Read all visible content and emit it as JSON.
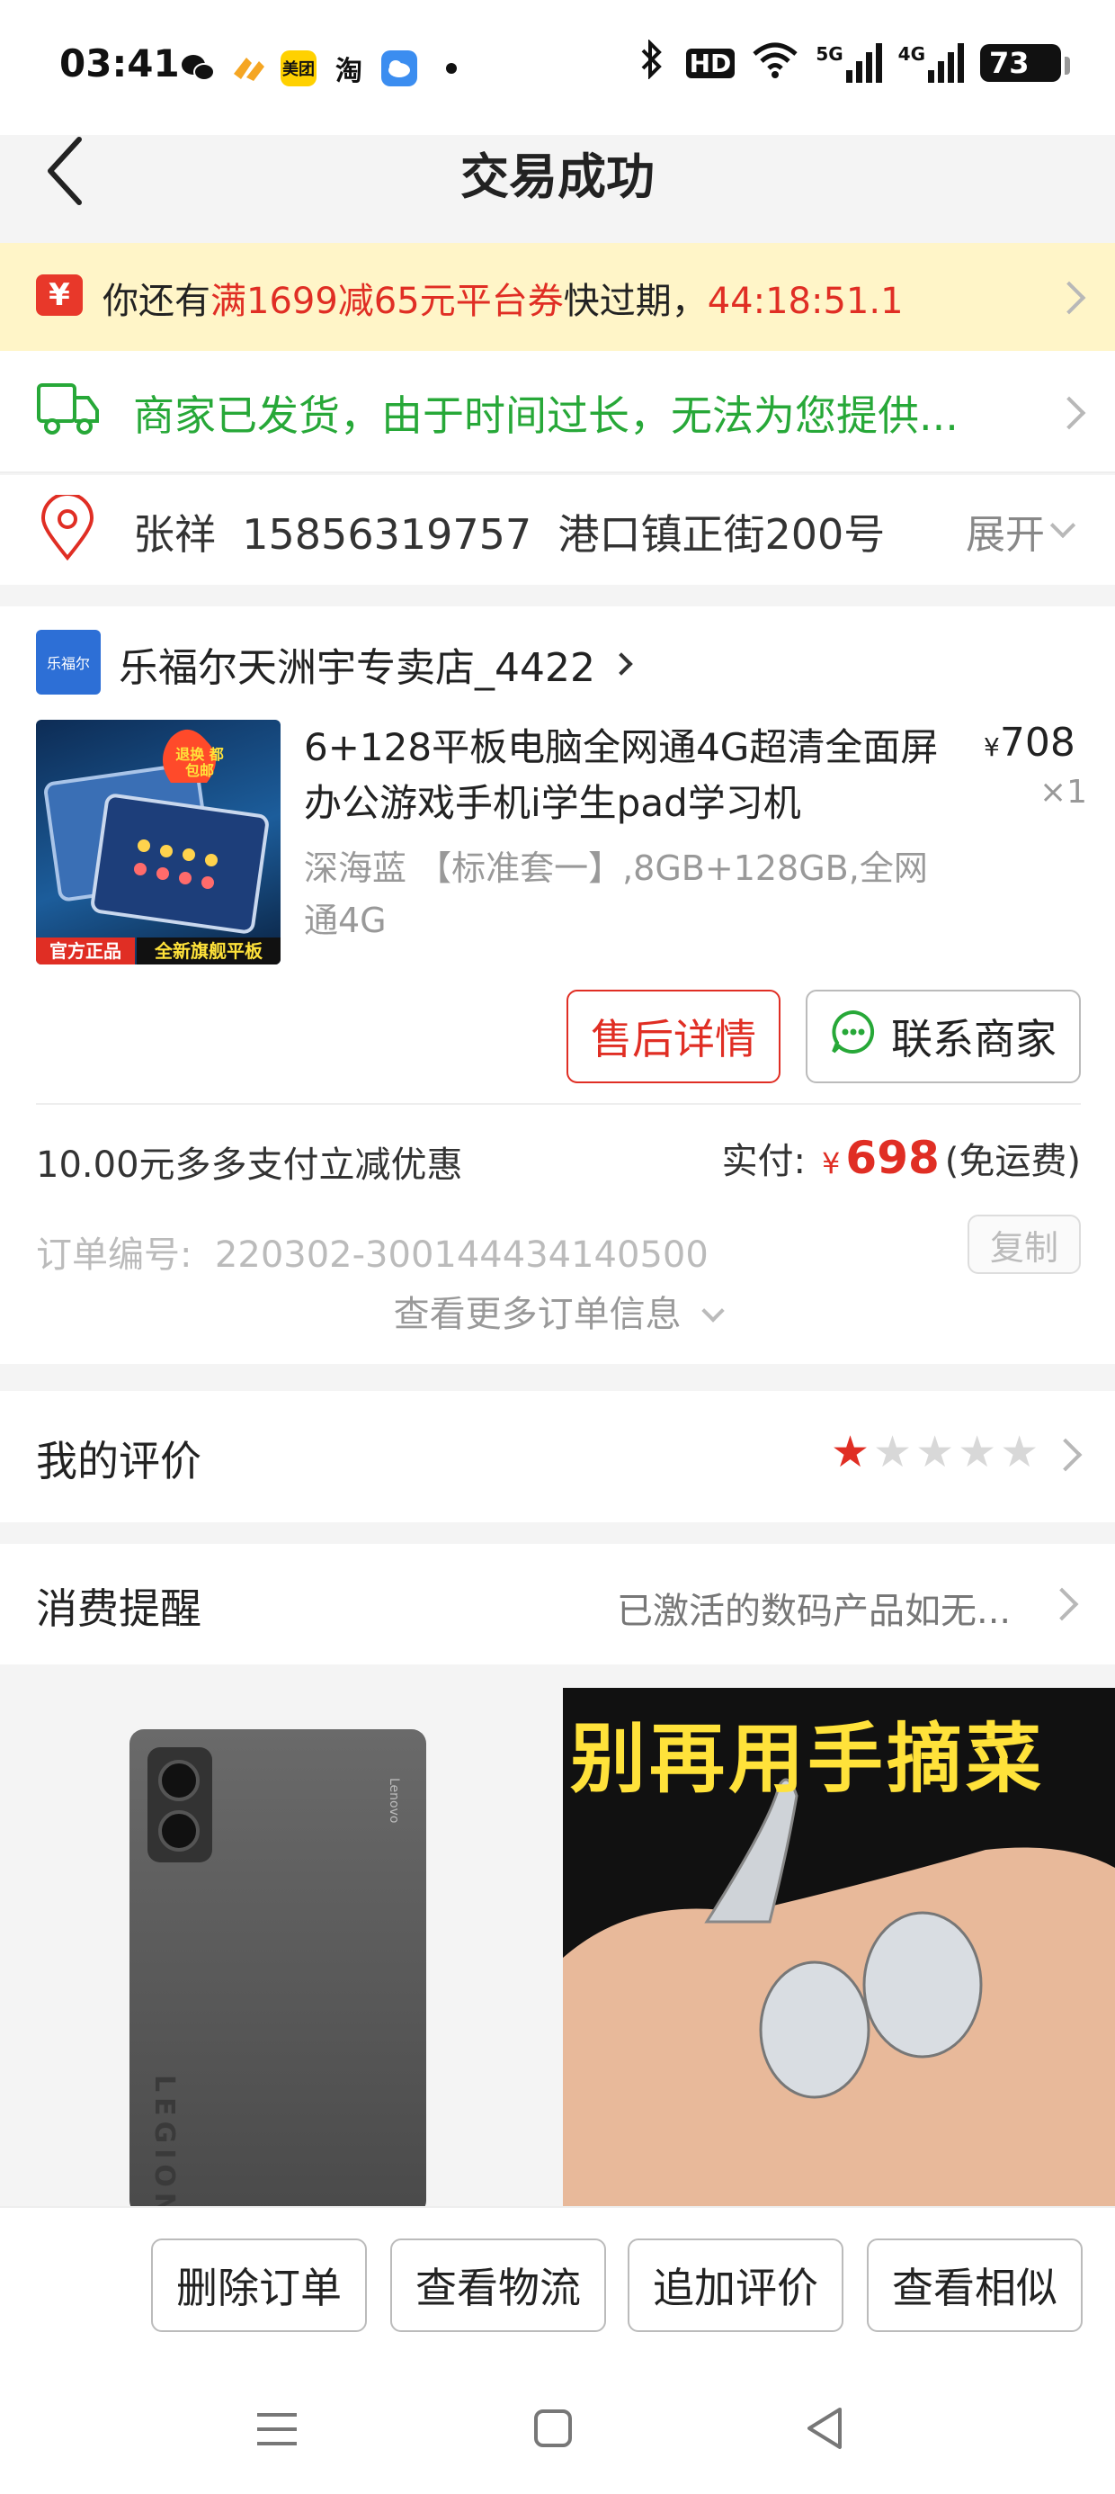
{
  "status_bar": {
    "time": "03:41",
    "apps": [
      {
        "icon": "wechat-icon",
        "color": "#111111",
        "label": ""
      },
      {
        "icon": "app-orange-icon",
        "color": "#f5a623",
        "label": ""
      },
      {
        "icon": "meituan-icon",
        "color": "#ffd100",
        "label": "美团"
      },
      {
        "icon": "taobao-icon",
        "color": "#ffffff",
        "label": "淘"
      },
      {
        "icon": "weather-icon",
        "color": "#3b8df0",
        "label": ""
      }
    ],
    "hd": "HD",
    "net_5g": "5G",
    "net_4g": "4G",
    "battery": "73"
  },
  "nav": {
    "title": "交易成功"
  },
  "coupon": {
    "icon": "¥",
    "prefix": "你还有",
    "highlight": "满1699减65元平台券",
    "middle": "快过期，",
    "countdown": "44:18:51.1"
  },
  "shipping": {
    "text": "商家已发货，由于时间过长，无法为您提供..."
  },
  "address": {
    "name": "张祥",
    "phone": "15856319757",
    "street": "港口镇正街200号",
    "expand_label": "展开"
  },
  "order": {
    "store_logo": "乐福尔",
    "store_name": "乐福尔天洲宇专卖店_4422",
    "product": {
      "badge_top": "退换 都包邮",
      "badge_left": "官方正品",
      "badge_right": "全新旗舰平板",
      "title": "6+128平板电脑全网通4G超清全面屏办公游戏手机i学生pad学习机",
      "spec": "深海蓝 【标准套一】,8GB+128GB,全网通4G",
      "currency": "¥",
      "price": "708",
      "quantity": "×1"
    },
    "aftersale_button": "售后详情",
    "contact_button": "联系商家",
    "discount_text": "10.00元多多支付立减优惠",
    "paid_label": "实付:",
    "paid_currency": "¥",
    "paid_amount": "698",
    "shipping_note": "(免运费)",
    "order_no_label": "订单编号:",
    "order_no": "220302-300144434140500",
    "copy_button": "复制",
    "more_info": "查看更多订单信息"
  },
  "review": {
    "label": "我的评价",
    "rating": 1,
    "max": 5
  },
  "reminder": {
    "label": "消费提醒",
    "value": "已激活的数码产品如无..."
  },
  "recommend": {
    "left_brand": "LEGION",
    "left_logo": "Lenovo",
    "right_headline": "别再用手摘菜"
  },
  "bottom_actions": [
    "删除订单",
    "查看物流",
    "追加评价",
    "查看相似"
  ],
  "colors": {
    "accent_red": "#e02e24",
    "green": "#27a838",
    "banner_bg": "#fff5c8"
  }
}
